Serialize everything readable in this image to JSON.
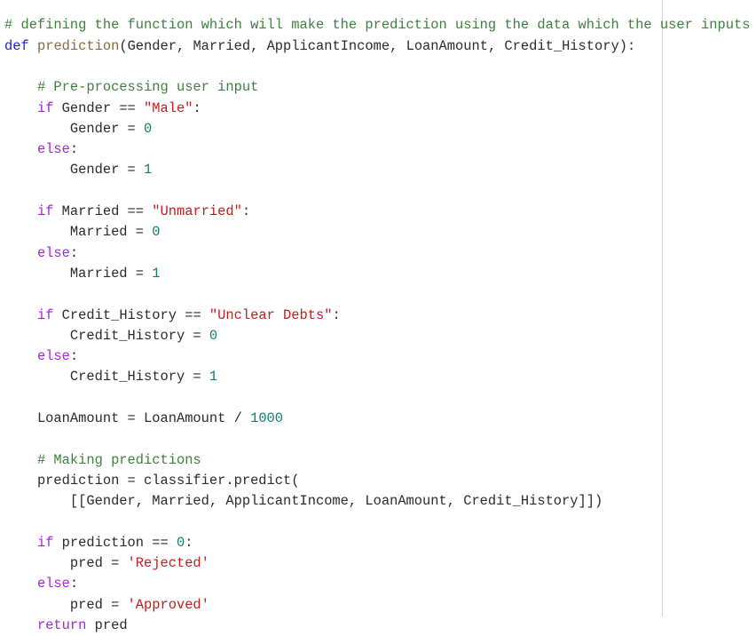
{
  "editor": {
    "language": "python",
    "background_color": "#ffffff",
    "margin_guide_color": "#d4d4d4",
    "margin_guide_column": 80,
    "palette": {
      "comment": "#3f7f3f",
      "keyword_def": "#2222cc",
      "keyword_flow": "#a626d6",
      "function_name": "#8a6a3d",
      "string": "#ba2121",
      "number": "#0e7f6e",
      "plain": "#2b2b2b"
    }
  },
  "code": {
    "lines": [
      {
        "n": 1,
        "text": "# defining the function which will make the prediction using the data which the user inputs",
        "tokens": [
          {
            "t": "# defining the function which will make the prediction using the data which the user inputs",
            "c": "comment"
          }
        ]
      },
      {
        "n": 2,
        "text": "def prediction(Gender, Married, ApplicantIncome, LoanAmount, Credit_History):",
        "tokens": [
          {
            "t": "def",
            "c": "kw-def"
          },
          {
            "t": " ",
            "c": "plain"
          },
          {
            "t": "prediction",
            "c": "funcname"
          },
          {
            "t": "(Gender, Married, ApplicantIncome, LoanAmount, Credit_History):",
            "c": "plain"
          }
        ]
      },
      {
        "n": 3,
        "text": "",
        "tokens": []
      },
      {
        "n": 4,
        "text": "    # Pre-processing user input",
        "tokens": [
          {
            "t": "    ",
            "c": "plain"
          },
          {
            "t": "# Pre-processing user input",
            "c": "comment"
          }
        ]
      },
      {
        "n": 5,
        "text": "    if Gender == \"Male\":",
        "tokens": [
          {
            "t": "    ",
            "c": "plain"
          },
          {
            "t": "if",
            "c": "kw-flow"
          },
          {
            "t": " Gender == ",
            "c": "plain"
          },
          {
            "t": "\"Male\"",
            "c": "string"
          },
          {
            "t": ":",
            "c": "plain"
          }
        ]
      },
      {
        "n": 6,
        "text": "        Gender = 0",
        "tokens": [
          {
            "t": "        Gender = ",
            "c": "plain"
          },
          {
            "t": "0",
            "c": "number"
          }
        ]
      },
      {
        "n": 7,
        "text": "    else:",
        "tokens": [
          {
            "t": "    ",
            "c": "plain"
          },
          {
            "t": "else",
            "c": "kw-flow"
          },
          {
            "t": ":",
            "c": "plain"
          }
        ]
      },
      {
        "n": 8,
        "text": "        Gender = 1",
        "tokens": [
          {
            "t": "        Gender = ",
            "c": "plain"
          },
          {
            "t": "1",
            "c": "number"
          }
        ]
      },
      {
        "n": 9,
        "text": "",
        "tokens": []
      },
      {
        "n": 10,
        "text": "    if Married == \"Unmarried\":",
        "tokens": [
          {
            "t": "    ",
            "c": "plain"
          },
          {
            "t": "if",
            "c": "kw-flow"
          },
          {
            "t": " Married == ",
            "c": "plain"
          },
          {
            "t": "\"Unmarried\"",
            "c": "string"
          },
          {
            "t": ":",
            "c": "plain"
          }
        ]
      },
      {
        "n": 11,
        "text": "        Married = 0",
        "tokens": [
          {
            "t": "        Married = ",
            "c": "plain"
          },
          {
            "t": "0",
            "c": "number"
          }
        ]
      },
      {
        "n": 12,
        "text": "    else:",
        "tokens": [
          {
            "t": "    ",
            "c": "plain"
          },
          {
            "t": "else",
            "c": "kw-flow"
          },
          {
            "t": ":",
            "c": "plain"
          }
        ]
      },
      {
        "n": 13,
        "text": "        Married = 1",
        "tokens": [
          {
            "t": "        Married = ",
            "c": "plain"
          },
          {
            "t": "1",
            "c": "number"
          }
        ]
      },
      {
        "n": 14,
        "text": "",
        "tokens": []
      },
      {
        "n": 15,
        "text": "    if Credit_History == \"Unclear Debts\":",
        "tokens": [
          {
            "t": "    ",
            "c": "plain"
          },
          {
            "t": "if",
            "c": "kw-flow"
          },
          {
            "t": " Credit_History == ",
            "c": "plain"
          },
          {
            "t": "\"Unclear Debts\"",
            "c": "string"
          },
          {
            "t": ":",
            "c": "plain"
          }
        ]
      },
      {
        "n": 16,
        "text": "        Credit_History = 0",
        "tokens": [
          {
            "t": "        Credit_History = ",
            "c": "plain"
          },
          {
            "t": "0",
            "c": "number"
          }
        ]
      },
      {
        "n": 17,
        "text": "    else:",
        "tokens": [
          {
            "t": "    ",
            "c": "plain"
          },
          {
            "t": "else",
            "c": "kw-flow"
          },
          {
            "t": ":",
            "c": "plain"
          }
        ]
      },
      {
        "n": 18,
        "text": "        Credit_History = 1",
        "tokens": [
          {
            "t": "        Credit_History = ",
            "c": "plain"
          },
          {
            "t": "1",
            "c": "number"
          }
        ]
      },
      {
        "n": 19,
        "text": "",
        "tokens": []
      },
      {
        "n": 20,
        "text": "    LoanAmount = LoanAmount / 1000",
        "tokens": [
          {
            "t": "    LoanAmount = LoanAmount / ",
            "c": "plain"
          },
          {
            "t": "1000",
            "c": "number"
          }
        ]
      },
      {
        "n": 21,
        "text": "",
        "tokens": []
      },
      {
        "n": 22,
        "text": "    # Making predictions",
        "tokens": [
          {
            "t": "    ",
            "c": "plain"
          },
          {
            "t": "# Making predictions",
            "c": "comment"
          }
        ]
      },
      {
        "n": 23,
        "text": "    prediction = classifier.predict(",
        "tokens": [
          {
            "t": "    prediction = classifier.predict(",
            "c": "plain"
          }
        ]
      },
      {
        "n": 24,
        "text": "        [[Gender, Married, ApplicantIncome, LoanAmount, Credit_History]])",
        "tokens": [
          {
            "t": "        [[Gender, Married, ApplicantIncome, LoanAmount, Credit_History]])",
            "c": "plain"
          }
        ]
      },
      {
        "n": 25,
        "text": "",
        "tokens": []
      },
      {
        "n": 26,
        "text": "    if prediction == 0:",
        "tokens": [
          {
            "t": "    ",
            "c": "plain"
          },
          {
            "t": "if",
            "c": "kw-flow"
          },
          {
            "t": " prediction == ",
            "c": "plain"
          },
          {
            "t": "0",
            "c": "number"
          },
          {
            "t": ":",
            "c": "plain"
          }
        ]
      },
      {
        "n": 27,
        "text": "        pred = 'Rejected'",
        "tokens": [
          {
            "t": "        pred = ",
            "c": "plain"
          },
          {
            "t": "'Rejected'",
            "c": "string"
          }
        ]
      },
      {
        "n": 28,
        "text": "    else:",
        "tokens": [
          {
            "t": "    ",
            "c": "plain"
          },
          {
            "t": "else",
            "c": "kw-flow"
          },
          {
            "t": ":",
            "c": "plain"
          }
        ]
      },
      {
        "n": 29,
        "text": "        pred = 'Approved'",
        "tokens": [
          {
            "t": "        pred = ",
            "c": "plain"
          },
          {
            "t": "'Approved'",
            "c": "string"
          }
        ]
      },
      {
        "n": 30,
        "text": "    return pred",
        "tokens": [
          {
            "t": "    ",
            "c": "plain"
          },
          {
            "t": "return",
            "c": "kw-flow"
          },
          {
            "t": " pred",
            "c": "plain"
          }
        ]
      }
    ]
  }
}
